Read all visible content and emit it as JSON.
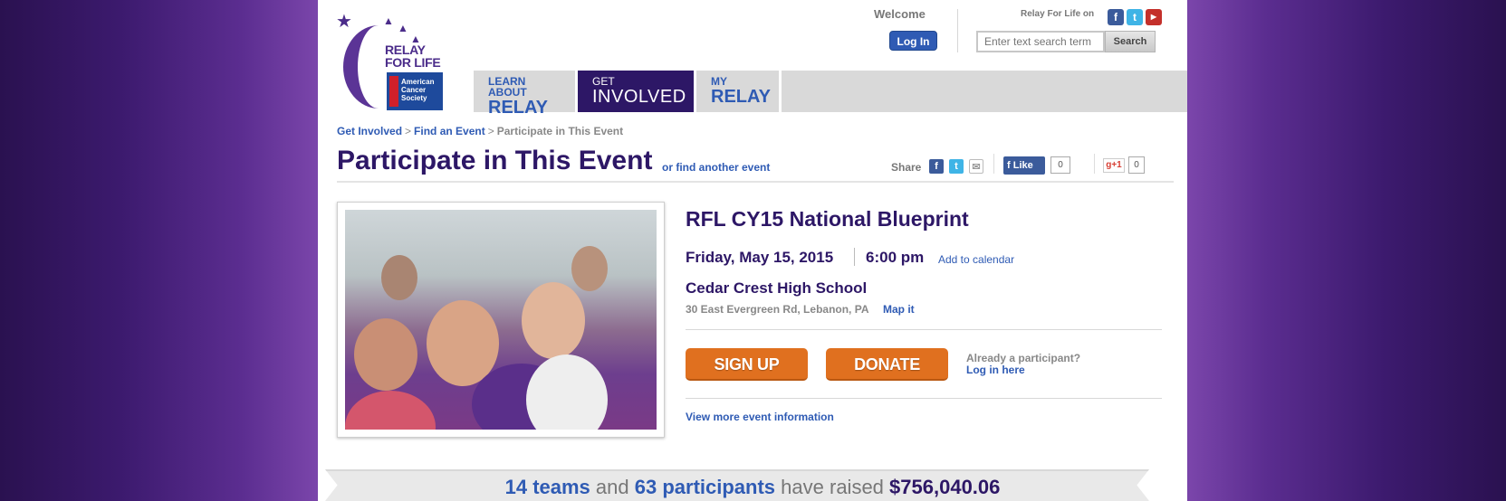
{
  "header": {
    "brand_line1": "RELAY",
    "brand_line2": "FOR LIFE",
    "acs_line1": "American",
    "acs_line2": "Cancer",
    "acs_line3": "Society",
    "welcome": "Welcome",
    "login_label": "Log In",
    "social_label": "Relay For Life on",
    "search_placeholder": "Enter text search term",
    "search_button": "Search"
  },
  "nav": {
    "tabs": [
      {
        "small": "LEARN ABOUT",
        "big": "RELAY"
      },
      {
        "small": "GET",
        "big": "INVOLVED"
      },
      {
        "small": "MY",
        "big": "RELAY"
      }
    ]
  },
  "breadcrumb": {
    "items": [
      "Get Involved",
      "Find an Event",
      "Participate in This Event"
    ],
    "separator": ">"
  },
  "title": {
    "text": "Participate in This Event",
    "find_another": "or find another event",
    "share": "Share",
    "like": "Like",
    "like_count": "0",
    "gplus": "g+1",
    "gplus_count": "0"
  },
  "event": {
    "name": "RFL CY15 National Blueprint",
    "date": "Friday, May 15, 2015",
    "time": "6:00 pm",
    "add_calendar": "Add to calendar",
    "venue": "Cedar Crest High School",
    "address": "30 East Evergreen Rd, Lebanon, PA",
    "map_it": "Map it",
    "sign_up": "SIGN UP",
    "donate": "DONATE",
    "already": "Already a participant?",
    "login_here": "Log in here",
    "view_more": "View more event information"
  },
  "banner": {
    "teams": "14 teams",
    "and": "and",
    "participants": "63 participants",
    "have_raised": "have raised",
    "amount": "$756,040.06"
  },
  "colors": {
    "brand_purple": "#2d1766",
    "link_blue": "#2f5bb4",
    "action_orange": "#e0701f"
  }
}
